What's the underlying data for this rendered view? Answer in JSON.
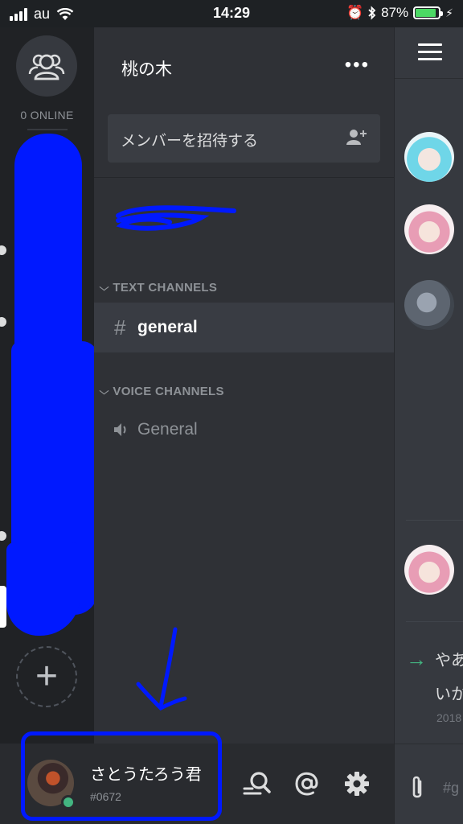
{
  "status_bar": {
    "carrier": "au",
    "time": "14:29",
    "battery": "87%",
    "battery_level": 0.87
  },
  "server_rail": {
    "online_label": "0 ONLINE",
    "add_server_glyph": "+"
  },
  "server": {
    "name": "桃の木",
    "more_glyph": "•••",
    "invite_label": "メンバーを招待する"
  },
  "categories": {
    "text": "TEXT CHANNELS",
    "voice": "VOICE CHANNELS"
  },
  "channels": {
    "text_hash": "#",
    "text_name": "general",
    "voice_name": "General"
  },
  "user": {
    "name": "さとうたろう君",
    "tag": "#0672",
    "status_color": "#43b581"
  },
  "chat_peek": {
    "message_line1": "やあ",
    "message_line2": "いか",
    "timestamp": "2018",
    "input_placeholder": "#g"
  },
  "colors": {
    "accent_online": "#43b581",
    "annotation_blue": "#0019ff",
    "rail_bg": "#202225",
    "panel_bg": "#2f3136"
  }
}
